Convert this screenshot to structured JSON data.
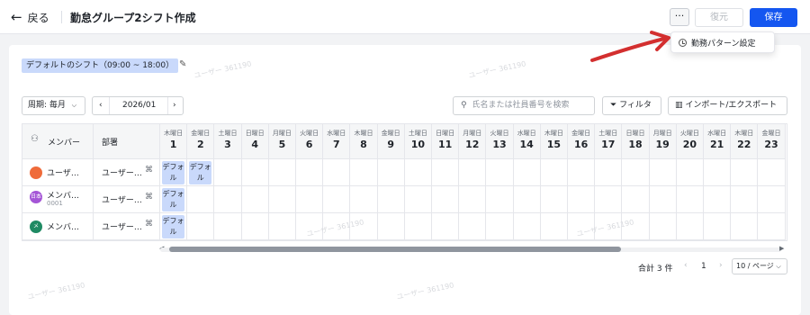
{
  "header": {
    "back_label": "戻る",
    "title": "勤怠グループ2シフト作成",
    "more_label": "···",
    "restore_label": "復元",
    "save_label": "保存"
  },
  "menu": {
    "item_label": "勤務パターン設定"
  },
  "shift_badge": "デフォルトのシフト（09:00 ~ 18:00）",
  "toolbar": {
    "period_label": "周期: 毎月",
    "month": "2026/01",
    "search_placeholder": "氏名または社員番号を検索",
    "filter_label": "フィルタ",
    "import_export_label": "インポート/エクスポート"
  },
  "table": {
    "member_header": "メンバー",
    "dept_header": "部署",
    "days": [
      {
        "wd": "木曜日",
        "d": "1"
      },
      {
        "wd": "金曜日",
        "d": "2"
      },
      {
        "wd": "土曜日",
        "d": "3"
      },
      {
        "wd": "日曜日",
        "d": "4"
      },
      {
        "wd": "月曜日",
        "d": "5"
      },
      {
        "wd": "火曜日",
        "d": "6"
      },
      {
        "wd": "水曜日",
        "d": "7"
      },
      {
        "wd": "木曜日",
        "d": "8"
      },
      {
        "wd": "金曜日",
        "d": "9"
      },
      {
        "wd": "土曜日",
        "d": "10"
      },
      {
        "wd": "日曜日",
        "d": "11"
      },
      {
        "wd": "月曜日",
        "d": "12"
      },
      {
        "wd": "火曜日",
        "d": "13"
      },
      {
        "wd": "水曜日",
        "d": "14"
      },
      {
        "wd": "木曜日",
        "d": "15"
      },
      {
        "wd": "金曜日",
        "d": "16"
      },
      {
        "wd": "土曜日",
        "d": "17"
      },
      {
        "wd": "日曜日",
        "d": "18"
      },
      {
        "wd": "月曜日",
        "d": "19"
      },
      {
        "wd": "火曜日",
        "d": "20"
      },
      {
        "wd": "水曜日",
        "d": "21"
      },
      {
        "wd": "木曜日",
        "d": "22"
      },
      {
        "wd": "金曜日",
        "d": "23"
      }
    ],
    "rows": [
      {
        "name": "ユーザ…",
        "sub": "",
        "avatar": "",
        "avatar_color": "#ef6b3a",
        "dept": "ユーザー…",
        "shift_days": [
          1,
          2
        ]
      },
      {
        "name": "メンバ…",
        "sub": "0001",
        "avatar": "日本",
        "avatar_color": "#a455d6",
        "dept": "ユーザー…",
        "shift_days": [
          1
        ]
      },
      {
        "name": "メンバ…",
        "sub": "",
        "avatar": "メ",
        "avatar_color": "#1f8a63",
        "dept": "ユーザー…",
        "shift_days": [
          1
        ]
      }
    ],
    "shift_chip_label": "デフォル"
  },
  "pagination": {
    "total_label": "合計 3 件",
    "current_page": "1",
    "page_size_label": "10 / ページ"
  },
  "watermark": "ユーザー 361190",
  "colors": {
    "primary": "#1456f0",
    "shift_chip": "#c9d9fb",
    "arrow": "#d32f2f"
  }
}
